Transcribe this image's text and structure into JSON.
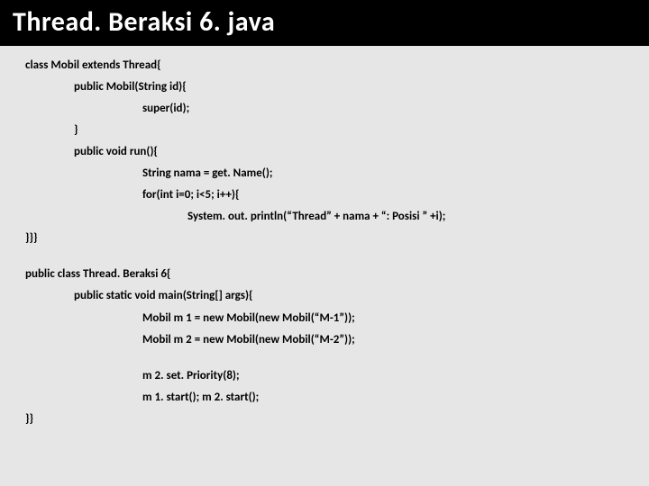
{
  "title": "Thread. Beraksi 6. java",
  "code": {
    "l1": "class Mobil extends Thread{",
    "l2": "public Mobil(String id){",
    "l3": "super(id);",
    "l4": "}",
    "l5": "public void run(){",
    "l6": "String nama = get. Name();",
    "l7": "for(int i=0; i<5; i++){",
    "l8": "System. out. println(“Thread” + nama + “: Posisi ” +i);",
    "l9": "}}}",
    "l10": "public class Thread. Beraksi 6{",
    "l11": "public static void main(String[] args){",
    "l12": "Mobil m 1 = new Mobil(new Mobil(“M-1”));",
    "l13": "Mobil m 2 = new Mobil(new Mobil(“M-2”));",
    "l14": "m 2. set. Priority(8);",
    "l15": "m 1. start(); m 2. start();",
    "l16": "}}"
  }
}
